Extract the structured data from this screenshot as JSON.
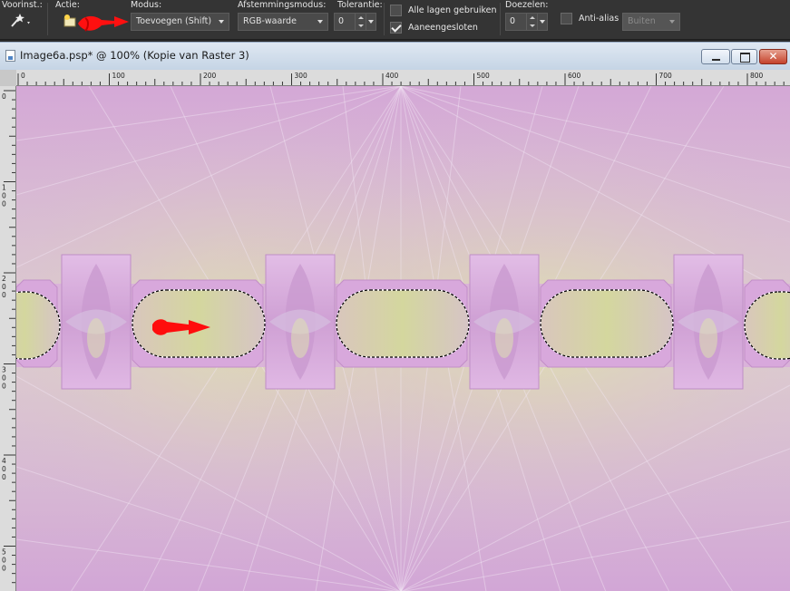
{
  "toolbar": {
    "preset_label": "Voorinst.:",
    "action_label": "Actie:",
    "mode_label": "Modus:",
    "mode_value": "Toevoegen (Shift)",
    "match_mode_label": "Afstemmingsmodus:",
    "match_mode_value": "RGB-waarde",
    "tolerance_label": "Tolerantie:",
    "tolerance_value": "0",
    "use_all_layers_label": "Alle lagen gebruiken",
    "use_all_layers_checked": false,
    "contiguous_label": "Aaneengesloten",
    "contiguous_checked": true,
    "feather_label": "Doezelen:",
    "feather_value": "0",
    "antialias_label": "Anti-alias",
    "antialias_checked": false,
    "antialias_mode_value": "Buiten"
  },
  "document": {
    "title": "Image6a.psp* @ 100% (Kopie van Raster 3)"
  },
  "rulers": {
    "h_labels": [
      "0",
      "100",
      "200",
      "300",
      "400",
      "500",
      "600",
      "700",
      "800"
    ],
    "v_labels": [
      "0",
      "100",
      "200",
      "300",
      "400",
      "500"
    ]
  },
  "colors": {
    "annotation_arrow": "#ff0000",
    "canvas_base": "#d8b2d8",
    "tile_fill": "#d6a8d8",
    "selection_marquee": "#000000"
  }
}
